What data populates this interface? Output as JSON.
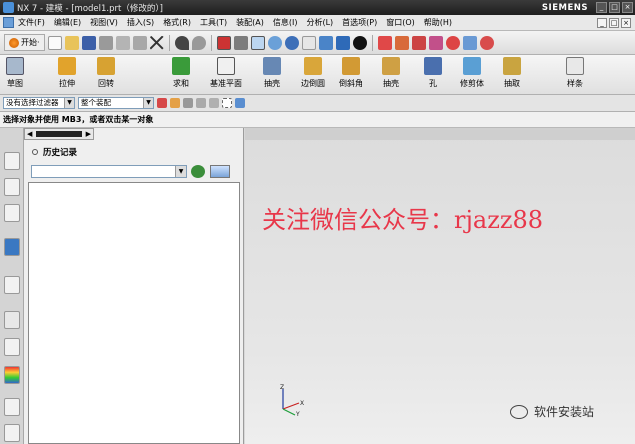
{
  "window": {
    "title": "NX 7 - 建模 - [model1.prt（修改的）]",
    "brand": "SIEMENS",
    "controls": [
      "_",
      "□",
      "×"
    ]
  },
  "menu": [
    "文件(F)",
    "编辑(E)",
    "视图(V)",
    "插入(S)",
    "格式(R)",
    "工具(T)",
    "装配(A)",
    "信息(I)",
    "分析(L)",
    "首选项(P)",
    "窗口(O)",
    "帮助(H)"
  ],
  "toolbar1": {
    "start_label": "开始·"
  },
  "toolbar2": [
    {
      "label": "草图",
      "icon": "sketch-icon"
    },
    {
      "label": "拉伸",
      "icon": "extrude-icon"
    },
    {
      "label": "回转",
      "icon": "revolve-icon"
    },
    {
      "label": "求和",
      "icon": "unite-icon"
    },
    {
      "label": "基准平面",
      "icon": "datum-plane-icon"
    },
    {
      "label": "抽壳",
      "icon": "shell-icon"
    },
    {
      "label": "边倒圆",
      "icon": "edge-blend-icon"
    },
    {
      "label": "倒斜角",
      "icon": "chamfer-icon"
    },
    {
      "label": "抽壳",
      "icon": "shell2-icon"
    },
    {
      "label": "孔",
      "icon": "hole-icon"
    },
    {
      "label": "修剪体",
      "icon": "trim-body-icon"
    },
    {
      "label": "抽取",
      "icon": "extract-icon"
    },
    {
      "label": "样条",
      "icon": "spline-icon"
    }
  ],
  "toolbar3": {
    "filter": "没有选择过滤器",
    "scope": "整个装配"
  },
  "status": "选择对象并使用 MB3，或者双击某一对象",
  "panel": {
    "history_label": "历史记录"
  },
  "viewport": {
    "watermark": "关注微信公众号：rjazz88",
    "axis_z": "Z",
    "axis_x": "X",
    "axis_y": "Y",
    "corner_label": "软件安装站"
  }
}
